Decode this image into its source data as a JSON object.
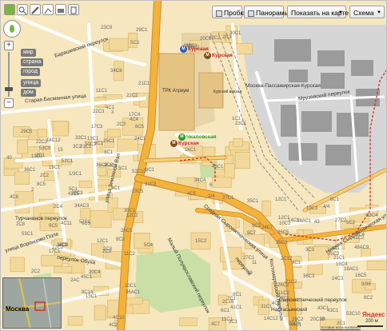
{
  "toolbar": {
    "traffic": "Пробки",
    "panoramas": "Панорамы",
    "show_on_map": "Показать на карте",
    "map_type": "Схема"
  },
  "zoom_levels": [
    "мир",
    "страна",
    "город",
    "улица",
    "дом"
  ],
  "metro": {
    "kurskaya_top_1": "Курская",
    "kurskaya_top_2": "Курская",
    "chkalovskaya": "Чкаловская",
    "kurskaya_bottom": "Курская"
  },
  "places": {
    "atrium": "ТРК Атриум",
    "kursky_station": "Курский вокзал"
  },
  "streets": {
    "barashevsky": "Барашевский переулок",
    "moskva_passazhirskaya": "Москва-Пассажирская-Курская",
    "zemlyanoy_val": "улица Земляной Вал",
    "vorontsovo_pole": "улица Воронцово Поле",
    "obukha": "переулок Обуха",
    "staraya_basmannaya": "Старая Басманная улица",
    "malyy_poluyaroslavsky": "Малый Полуярославский переулок",
    "srednyaya_syromyatnicheskaya": "Средняя Сыромятническая улица",
    "kostomarovsky": "Костомаровский переулок",
    "nizhniy_syromyatnicheskaya": "Нижняя Сыромятническая улица",
    "mruzovsky": "Мрузовский переулок",
    "syromyatnicheskiy_2": "Сыромятнический переулок",
    "turchaninov": "Турчанинов переулок",
    "nastasyinsky": "Настасьинский",
    "tankovy": "переулок"
  },
  "buildings": [
    "21С1",
    "30",
    "34С3",
    "3С1",
    "8С2",
    "20С1",
    "29С2",
    "5С1",
    "19",
    "34С4",
    "24С1",
    "20С10",
    "10С2",
    "8С1",
    "12С1",
    "36С3",
    "2С2",
    "26С1",
    "5С4",
    "25С2",
    "29С5",
    "14С12",
    "34АС3",
    "36АС1",
    "36С1",
    "43С1",
    "4/4",
    "31С1",
    "22С3",
    "23С9",
    "27С1",
    "8С14",
    "8С8",
    "2АС",
    "2/13",
    "12С1",
    "21С2",
    "53С9",
    "24С7",
    "12С2",
    "2С4",
    "33С1",
    "24С3",
    "27С2",
    "15",
    "23С3",
    "8С1",
    "10С2",
    "4С11",
    "28С2",
    "2/4",
    "17С4",
    "25С1",
    "30С1",
    "41С1",
    "36С3",
    "22С2",
    "14С1",
    "28АС1",
    "6С5",
    "2С3",
    "2",
    "15С2",
    "2С12",
    "20С3",
    "27С1",
    "14С12",
    "52С10",
    "40",
    "35С5",
    "11С1",
    "41С2",
    "3С2",
    "52С1",
    "8С1",
    "41С5",
    "33С4",
    "13С1",
    "14С1",
    "9С5",
    "2С3",
    "3С1",
    "16С4",
    "23С5",
    "29С1",
    "53С10",
    "57С1",
    "8С5",
    "3С3",
    "30С1",
    "44С1",
    "5С2",
    "26С2",
    "9С7",
    "22С2",
    "48С1",
    "4С8",
    "20С4",
    "18АС1",
    "11С2",
    "4С5",
    "19С3",
    "4С1",
    "45С1",
    "1С1",
    "21С1",
    "4С4",
    "3С1",
    "40С2",
    "31С3",
    "53С1",
    "23С1",
    "4С10",
    "4",
    "8С2",
    "8С1",
    "6С1",
    "19С1",
    "43С1",
    "11С2",
    "45С1",
    "2С1",
    "5С3",
    "9/36",
    "48АС9",
    "13С1",
    "28С1",
    "20С3",
    "17С1",
    "22С2",
    "2С16",
    "3",
    "35С1",
    "9С3",
    "4С7",
    "28С3",
    "3С4",
    "11",
    "1/3С1",
    "2С1",
    "9С1",
    "7С1",
    "14С3",
    "16С5",
    "2С3",
    "12С1",
    "4С1",
    "6",
    "10С1",
    "15С1",
    "3С2",
    "6С1",
    "2С2",
    "11С1",
    "21С1",
    "2С8",
    "17С3",
    "5С1",
    "8С5",
    "43",
    "4С5",
    "4С2"
  ],
  "minimap": {
    "label": "Москва"
  },
  "attribution": {
    "logo": "Яндекс",
    "scale": "200 м",
    "terms": "Условия использования"
  },
  "colors": {
    "background": "#f6e7bf",
    "road": "#ffffff",
    "main_road": "#f3b33a",
    "main_road_edge": "#d4882a",
    "building": "#f2d89a",
    "building_edge": "#d8b869",
    "railway_area": "#d6d6d6",
    "park": "#c9dfa6",
    "dark_building": "#9a9a9a",
    "route": "#d22b2b"
  }
}
